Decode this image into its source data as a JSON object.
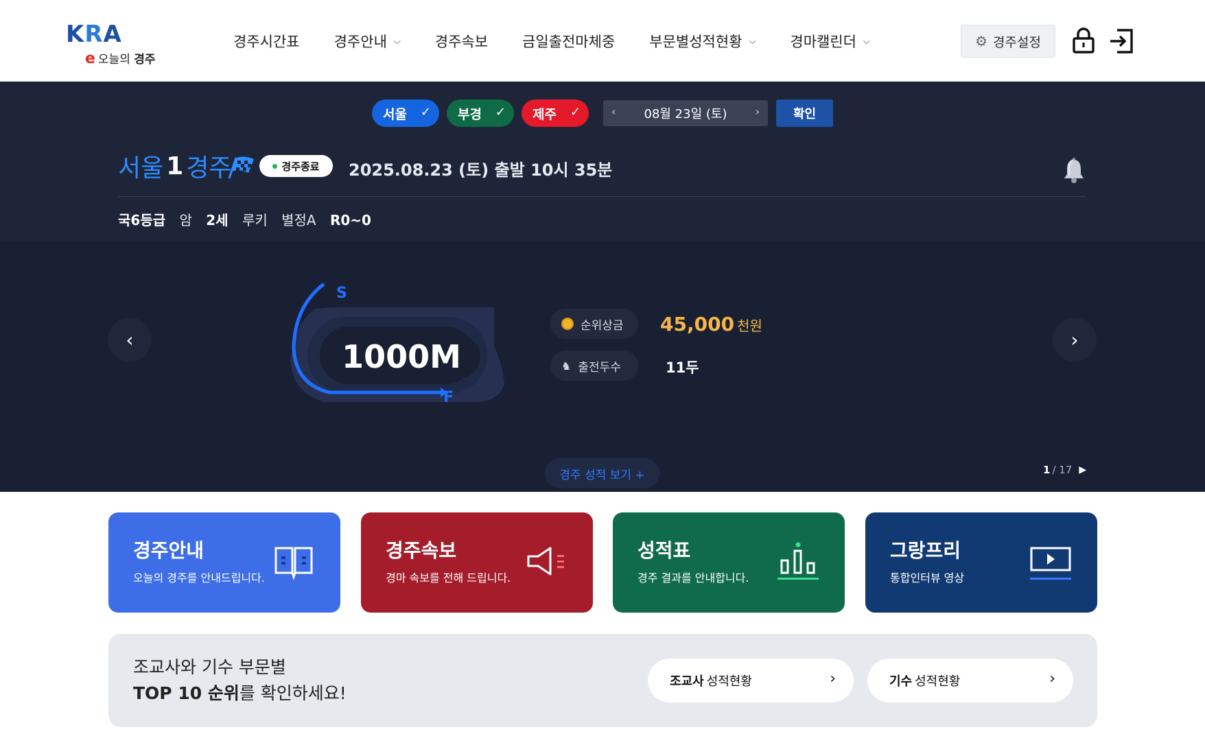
{
  "header": {
    "logo_text": "KRA",
    "logo_sub_e": "e",
    "logo_sub_today": "오늘의",
    "logo_sub_race": "경주",
    "nav": [
      {
        "label": "경주시간표"
      },
      {
        "label": "경주안내",
        "chevron": true
      },
      {
        "label": "경주속보"
      },
      {
        "label": "금일출전마체중"
      },
      {
        "label": "부문별성적현황",
        "chevron": true
      },
      {
        "label": "경마캘린더",
        "chevron": true
      }
    ],
    "settings_label": "경주설정"
  },
  "filters": {
    "tracks": [
      {
        "label": "서울",
        "checked": true,
        "color": "#1565e0"
      },
      {
        "label": "부경",
        "checked": true,
        "color": "#0f6b46"
      },
      {
        "label": "제주",
        "checked": true,
        "color": "#e4192a"
      }
    ],
    "date": "08월 23일 (토)",
    "confirm_label": "확인"
  },
  "race": {
    "track": "서울",
    "number": "1",
    "unit": "경주",
    "status": "경주종료",
    "datetime": "2025.08.23 (토)  출발 10시 35분",
    "conditions": {
      "grade": "국6등급",
      "sex": "암",
      "age": "2세",
      "type": "루키",
      "weight": "별정A",
      "rating": "R0~0"
    },
    "distance": "1000M",
    "track_start_label": "S",
    "track_finish_label": "F",
    "prize_label": "순위상금",
    "prize_value": "45,000",
    "prize_unit": "천원",
    "horses_label": "출전두수",
    "horses_value": "11두",
    "results_label": "경주 성적 보기 +",
    "page_current": "1",
    "page_total": "/ 17"
  },
  "cards": [
    {
      "title": "경주안내",
      "desc": "오늘의 경주를 안내드립니다.",
      "icon": "book-icon",
      "color": "#3d6ee8"
    },
    {
      "title": "경주속보",
      "desc": "경마 속보를 전해 드립니다.",
      "icon": "megaphone-icon",
      "color": "#a51d2a"
    },
    {
      "title": "성적표",
      "desc": "경주 결과를 안내합니다.",
      "icon": "podium-chart-icon",
      "color": "#0f6b4b"
    },
    {
      "title": "그랑프리",
      "desc": "통합인터뷰 영상",
      "icon": "video-play-icon",
      "color": "#123a72"
    }
  ],
  "ranking": {
    "line1": "조교사와 기수 부문별",
    "line2_bold": "TOP 10 순위",
    "line2_rest": "를 확인하세요!",
    "trainer_bold": "조교사",
    "trainer_rest": "성적현황",
    "jockey_bold": "기수",
    "jockey_rest": "성적현황"
  }
}
